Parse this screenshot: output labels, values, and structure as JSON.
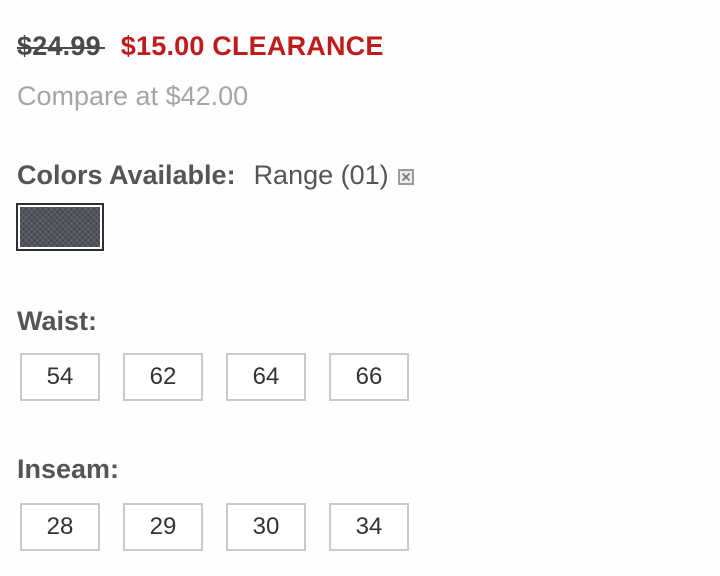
{
  "pricing": {
    "original_price": "$24.99",
    "sale_price": "$15.00 CLEARANCE",
    "compare_text": "Compare at $42.00"
  },
  "colors": {
    "label": "Colors Available:",
    "selected": "Range (01)",
    "clear_icon": "close-box-icon",
    "swatch_color": "#4d5158"
  },
  "waist": {
    "label": "Waist:",
    "options": [
      "54",
      "62",
      "64",
      "66"
    ]
  },
  "inseam": {
    "label": "Inseam:",
    "options": [
      "28",
      "29",
      "30",
      "34"
    ]
  },
  "theme": {
    "sale_red": "#bf1b1b",
    "muted_gray": "#a3a5a8",
    "border_gray": "#c9c9c9"
  }
}
